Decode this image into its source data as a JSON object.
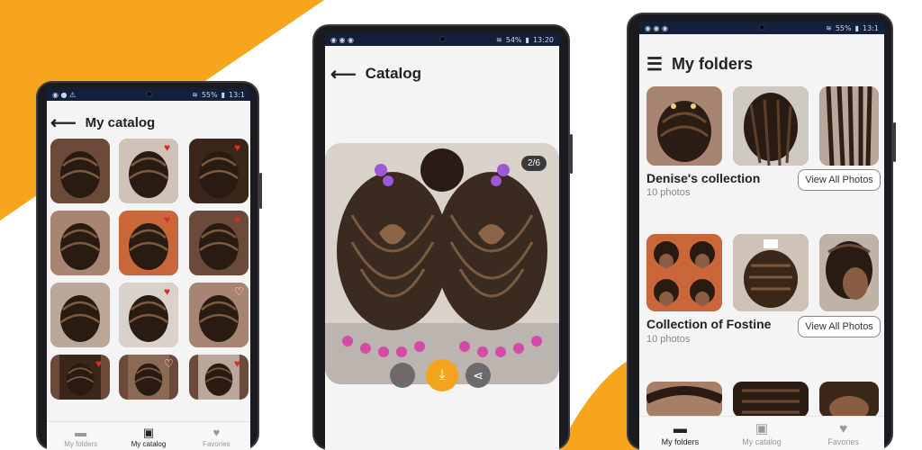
{
  "colors": {
    "accent": "#f7a51c",
    "statusbar": "#12203c",
    "heart": "#e3282a",
    "download": "#f2a51c"
  },
  "left_phone": {
    "status": {
      "icons": "◉ ● ⚠",
      "battery": "55%",
      "time": "13:1"
    },
    "title": "My catalog",
    "back_icon": "arrow-left-icon",
    "nav": [
      {
        "label": "My folders",
        "icon": "folder-icon"
      },
      {
        "label": "My catalog",
        "icon": "image-icon"
      },
      {
        "label": "Favories",
        "icon": "heart-icon"
      }
    ]
  },
  "center_phone": {
    "status": {
      "icons": "◉ ◉ ◉",
      "battery": "54%",
      "time": "13:20"
    },
    "title": "Catalog",
    "back_icon": "arrow-left-icon",
    "counter": "2/6",
    "actions": [
      "favorite",
      "download",
      "share"
    ]
  },
  "right_phone": {
    "status": {
      "icons": "◉ ◉ ◉",
      "battery": "55%",
      "time": "13:1"
    },
    "title": "My folders",
    "menu_icon": "hamburger-menu-icon",
    "folders": [
      {
        "name": "Denise's collection",
        "count": "10 photos",
        "button": "View All Photos"
      },
      {
        "name": "Collection of Fostine",
        "count": "10 photos",
        "button": "View All Photos"
      }
    ],
    "nav": [
      {
        "label": "My folders",
        "icon": "folder-icon"
      },
      {
        "label": "My catalog",
        "icon": "image-icon"
      },
      {
        "label": "Favories",
        "icon": "heart-icon"
      }
    ]
  }
}
